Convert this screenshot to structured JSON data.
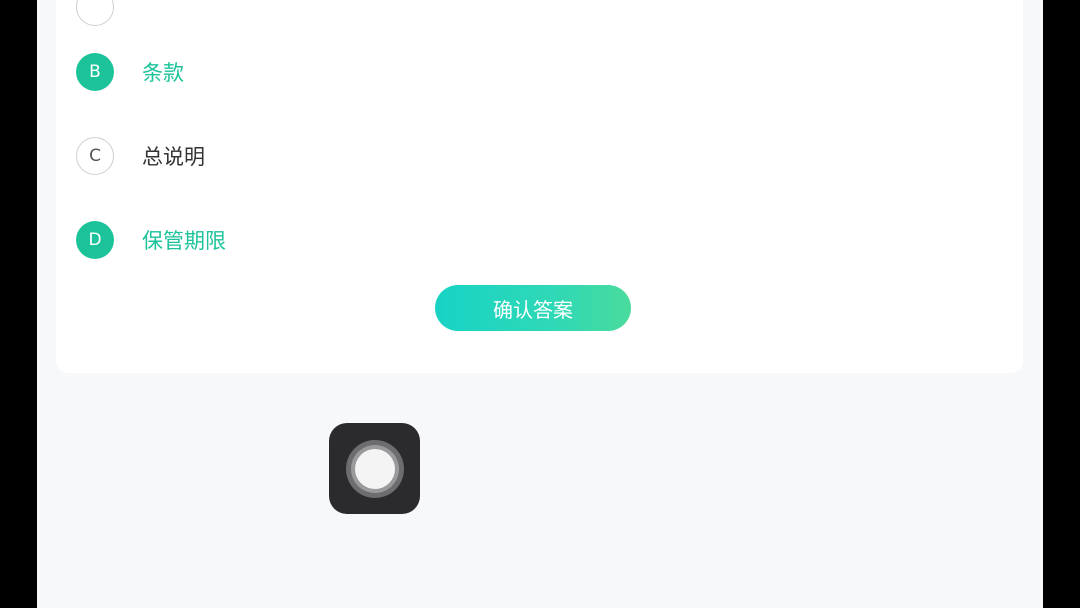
{
  "quiz": {
    "options": [
      {
        "letter": "",
        "text": "",
        "selected": false
      },
      {
        "letter": "B",
        "text": "条款",
        "selected": true
      },
      {
        "letter": "C",
        "text": "总说明",
        "selected": false
      },
      {
        "letter": "D",
        "text": "保管期限",
        "selected": true
      }
    ],
    "confirm_label": "确认答案"
  },
  "icons": {
    "assistive_touch": "assistive-touch-icon"
  },
  "colors": {
    "accent": "#1cc39a",
    "button_gradient_start": "#17d3c5",
    "button_gradient_end": "#49db9d",
    "page_background": "#f7f8fa"
  }
}
